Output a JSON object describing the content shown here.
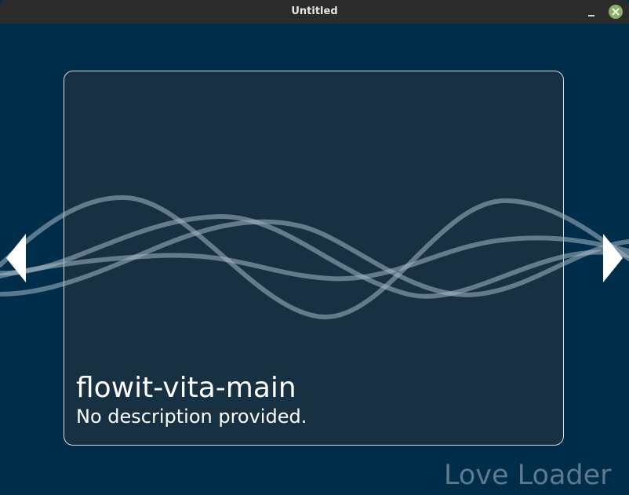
{
  "window": {
    "title": "Untitled",
    "minimize_icon": "minimize-icon",
    "close_icon": "close-icon",
    "close_color": "#8bb06a"
  },
  "project": {
    "name": "flowit-vita-main",
    "description": "No description provided."
  },
  "navigation": {
    "previous_icon": "triangle-left-icon",
    "next_icon": "triangle-right-icon"
  },
  "branding": {
    "text": "Love Loader"
  },
  "colors": {
    "background": "#002e4a",
    "card": "#173142",
    "card_border": "#d7dde2",
    "wave": "#a6b8c4",
    "watermark": "#5d7a8c"
  }
}
